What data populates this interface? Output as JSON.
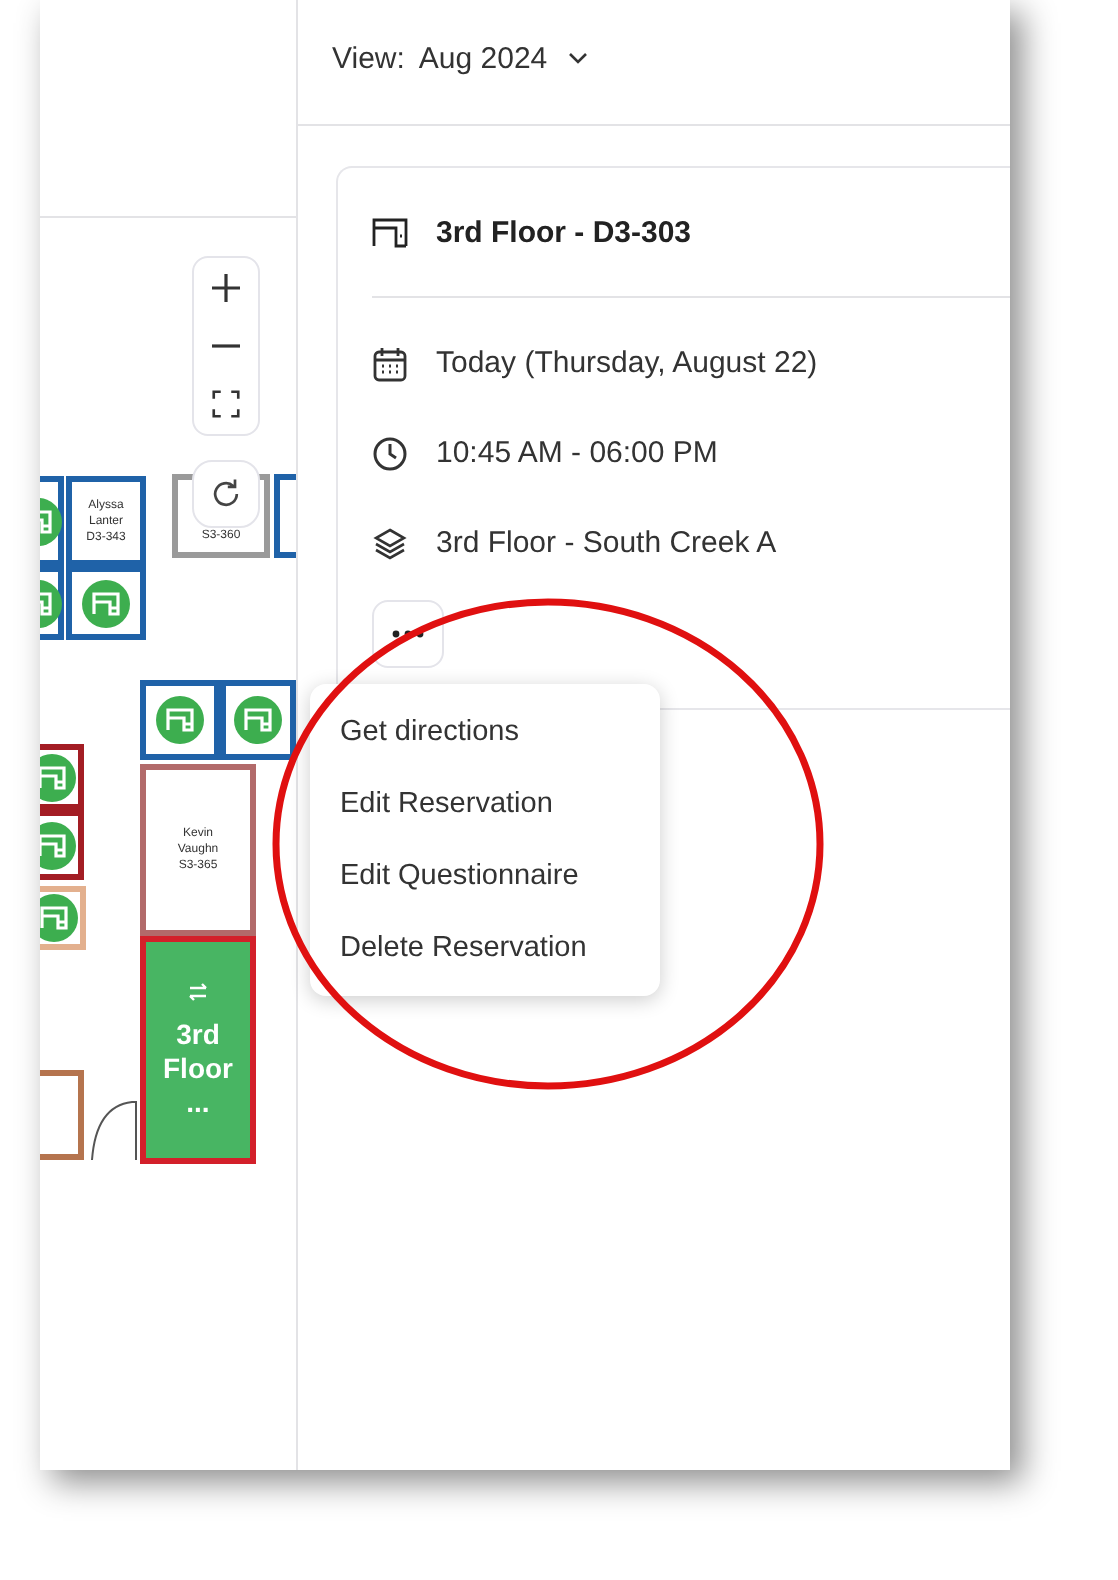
{
  "view": {
    "label": "View:",
    "value": "Aug 2024"
  },
  "map": {
    "desks": [
      {
        "kind": "available",
        "color": "#1f62a8"
      },
      {
        "kind": "booked",
        "color": "#1f62a8",
        "lines": [
          "Alyssa",
          "Lanter",
          "D3-343"
        ]
      },
      {
        "kind": "booked",
        "color": "#9a9a9a",
        "lines": [
          "S3-360"
        ]
      },
      {
        "kind": "empty",
        "color": "#1f62a8"
      },
      {
        "kind": "available",
        "color": "#1f62a8"
      },
      {
        "kind": "available",
        "color": "#1f62a8"
      },
      {
        "kind": "available",
        "color": "#1f62a8"
      },
      {
        "kind": "available",
        "color": "#1f62a8"
      },
      {
        "kind": "available",
        "color": "#a31d24"
      },
      {
        "kind": "available",
        "color": "#a31d24"
      },
      {
        "kind": "available",
        "color": "#e3b08e"
      },
      {
        "kind": "booked",
        "color": "#b26a6a",
        "lines": [
          "Kevin",
          "Vaughn",
          "S3-365"
        ]
      },
      {
        "kind": "selected",
        "color": "#d3202a",
        "lines": [
          "3rd",
          "Floor",
          "..."
        ]
      },
      {
        "kind": "empty",
        "color": "#b5744e"
      }
    ]
  },
  "details": {
    "title": "3rd Floor - D3-303",
    "rows": [
      {
        "kind": "date",
        "text": "Today (Thursday, August 22)"
      },
      {
        "kind": "time",
        "text": "10:45 AM - 06:00 PM"
      },
      {
        "kind": "floor",
        "text": "3rd Floor - South Creek A"
      }
    ]
  },
  "menu": [
    {
      "label": "Get directions"
    },
    {
      "label": "Edit Reservation"
    },
    {
      "label": "Edit Questionnaire"
    },
    {
      "label": "Delete Reservation"
    }
  ]
}
